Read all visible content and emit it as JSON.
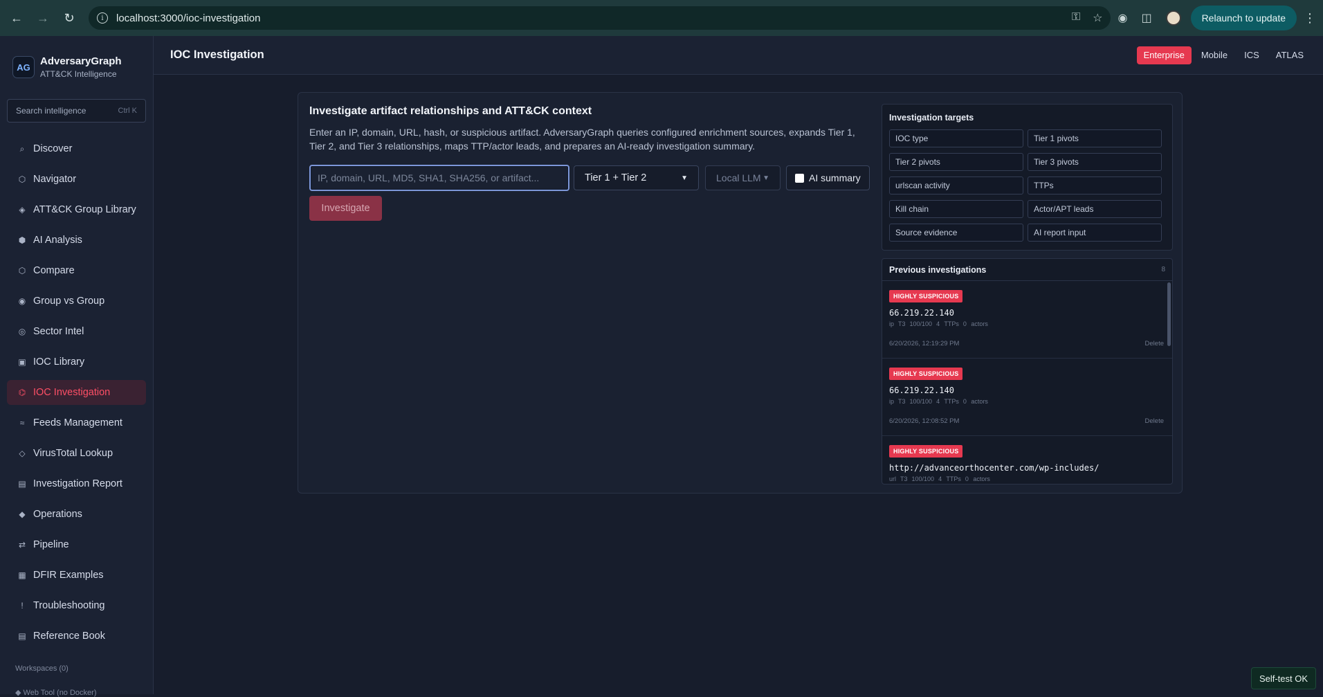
{
  "browser": {
    "url": "localhost:3000/ioc-investigation",
    "relaunch_label": "Relaunch to update"
  },
  "brand": {
    "name": "AdversaryGraph",
    "subtitle": "ATT&CK Intelligence",
    "logo_text": "AG"
  },
  "search": {
    "placeholder": "Search intelligence",
    "shortcut": "Ctrl K"
  },
  "sidebar": {
    "items": [
      {
        "label": "Discover",
        "icon": "⌕"
      },
      {
        "label": "Navigator",
        "icon": "⬡"
      },
      {
        "label": "ATT&CK Group Library",
        "icon": "◈"
      },
      {
        "label": "AI Analysis",
        "icon": "⬢"
      },
      {
        "label": "Compare",
        "icon": "⬡"
      },
      {
        "label": "Group vs Group",
        "icon": "◉"
      },
      {
        "label": "Sector Intel",
        "icon": "◎"
      },
      {
        "label": "IOC Library",
        "icon": "▣"
      },
      {
        "label": "IOC Investigation",
        "icon": "⌬"
      },
      {
        "label": "Feeds Management",
        "icon": "≈"
      },
      {
        "label": "VirusTotal Lookup",
        "icon": "◇"
      },
      {
        "label": "Investigation Report",
        "icon": "▤"
      },
      {
        "label": "Operations",
        "icon": "◆"
      },
      {
        "label": "Pipeline",
        "icon": "⇄"
      },
      {
        "label": "DFIR Examples",
        "icon": "▦"
      },
      {
        "label": "Troubleshooting",
        "icon": "!"
      },
      {
        "label": "Reference Book",
        "icon": "▤"
      }
    ],
    "active_index": 8,
    "workspaces": "Workspaces (0)",
    "web_tool": "◆ Web Tool (no Docker)"
  },
  "header": {
    "title": "IOC Investigation",
    "domain_tabs": [
      "Enterprise",
      "Mobile",
      "ICS",
      "ATLAS"
    ],
    "active_tab": "Enterprise"
  },
  "main": {
    "heading": "Investigate artifact relationships and ATT&CK context",
    "description": "Enter an IP, domain, URL, hash, or suspicious artifact. AdversaryGraph queries configured enrichment sources, expands Tier 1, Tier 2, and Tier 3 relationships, maps TTP/actor leads, and prepares an AI-ready investigation summary.",
    "input_placeholder": "IP, domain, URL, MD5, SHA1, SHA256, or artifact...",
    "tier_select": "Tier 1 + Tier 2",
    "llm_select": "Local LLM",
    "ai_summary_label": "AI summary",
    "investigate_label": "Investigate"
  },
  "targets": {
    "title": "Investigation targets",
    "items": [
      "IOC type",
      "Tier 1 pivots",
      "Tier 2 pivots",
      "Tier 3 pivots",
      "urlscan activity",
      "TTPs",
      "Kill chain",
      "Actor/APT leads",
      "Source evidence",
      "AI report input"
    ]
  },
  "previous": {
    "title": "Previous investigations",
    "count": "8",
    "delete_label": "Delete",
    "entries": [
      {
        "verdict": "HIGHLY SUSPICIOUS",
        "ioc": "66.219.22.140",
        "type": "ip",
        "tier": "T3",
        "score": "100/100",
        "ttps": "4 TTPs",
        "actors": "0 actors",
        "timestamp": "6/20/2026, 12:19:29 PM"
      },
      {
        "verdict": "HIGHLY SUSPICIOUS",
        "ioc": "66.219.22.140",
        "type": "ip",
        "tier": "T3",
        "score": "100/100",
        "ttps": "4 TTPs",
        "actors": "0 actors",
        "timestamp": "6/20/2026, 12:08:52 PM"
      },
      {
        "verdict": "HIGHLY SUSPICIOUS",
        "ioc": "http://advanceorthocenter.com/wp-includes/",
        "type": "url",
        "tier": "T3",
        "score": "100/100",
        "ttps": "4 TTPs",
        "actors": "0 actors",
        "timestamp": ""
      }
    ]
  },
  "status": {
    "self_test": "Self-test OK"
  }
}
